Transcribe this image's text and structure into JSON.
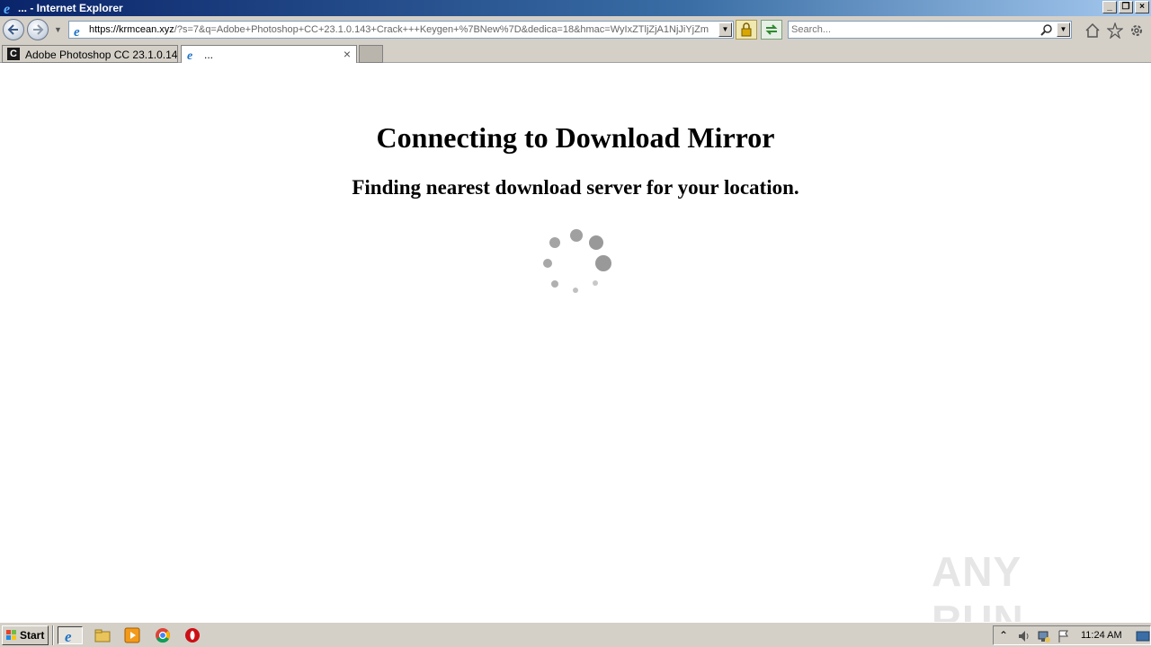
{
  "window": {
    "title": "... - Internet Explorer",
    "controls": [
      "minimize",
      "restore",
      "close"
    ]
  },
  "navbar": {
    "address_host": "https://krmcean.xyz",
    "address_rest": "/?s=7&q=Adobe+Photoshop+CC+23.1.0.143+Crack+++Keygen+%7BNew%7D&dedica=18&hmac=WyIxZTljZjA1NjJiYjZm",
    "search_placeholder": "Search..."
  },
  "tabs": [
    {
      "label": "Adobe Photoshop CC 23.1.0.14...",
      "icon": "c-letter-icon",
      "active": false
    },
    {
      "label": "...",
      "icon": "ie-icon",
      "active": true
    }
  ],
  "page": {
    "heading": "Connecting to Download Mirror",
    "subheading": "Finding nearest download server for your location."
  },
  "watermark": "ANY RUN",
  "taskbar": {
    "start_label": "Start",
    "clock": "11:24 AM",
    "quick_launch": [
      "ie-icon",
      "explorer-icon",
      "media-player-icon",
      "chrome-icon",
      "opera-icon"
    ]
  },
  "colors": {
    "titlebar_start": "#0a246a",
    "titlebar_end": "#a6caf0",
    "chrome": "#d4d0c8",
    "spinner": "#999999"
  }
}
